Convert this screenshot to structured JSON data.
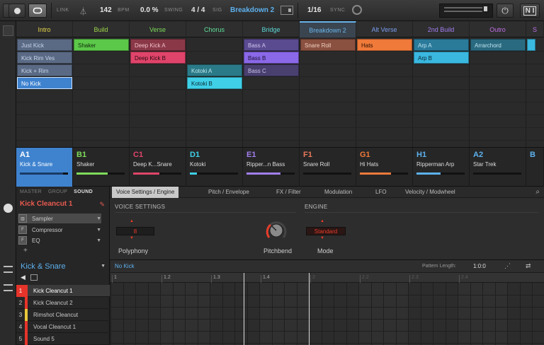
{
  "transport": {
    "link_label": "LINK",
    "tempo": "142",
    "tempo_unit": "BPM",
    "swing": "0.0 %",
    "swing_label": "SWING",
    "signature": "4 / 4",
    "signature_label": "SIG",
    "scene_name": "Breakdown 2",
    "quantize": "1/16",
    "sync_label": "SYNC",
    "accent_color": "#5db1ee"
  },
  "scenes": [
    {
      "label": "Intro",
      "color": "#e8d84a"
    },
    {
      "label": "Build",
      "color": "#9fd84a"
    },
    {
      "label": "Verse",
      "color": "#7edc5a"
    },
    {
      "label": "Chorus",
      "color": "#5ee09a"
    },
    {
      "label": "Bridge",
      "color": "#5ed8d8"
    },
    {
      "label": "Breakdown 2",
      "color": "#6ab4e8",
      "active": true
    },
    {
      "label": "Alt Verse",
      "color": "#7a9ef0"
    },
    {
      "label": "2nd Build",
      "color": "#a27ef0"
    },
    {
      "label": "Outro",
      "color": "#c070e8"
    }
  ],
  "clips": [
    {
      "col": 0,
      "row": 0,
      "label": "Just Kick",
      "color": "#5a6a85",
      "text_color": "#c8d4e8"
    },
    {
      "col": 0,
      "row": 1,
      "label": "Kick Rim Ves",
      "color": "#5a6a85",
      "text_color": "#c8d4e8"
    },
    {
      "col": 0,
      "row": 2,
      "label": "Kick + Rim",
      "color": "#5a6a85",
      "text_color": "#c8d4e8"
    },
    {
      "col": 0,
      "row": 3,
      "label": "No Kick",
      "color": "#3f83cf",
      "text_color": "#ffffff",
      "selected": true
    },
    {
      "col": 1,
      "row": 0,
      "label": "Shaker",
      "color": "#5cc84a",
      "text_color": "#0f2a0a"
    },
    {
      "col": 2,
      "row": 0,
      "label": "Deep Kick A",
      "color": "#8a3848",
      "text_color": "#f0c0c8"
    },
    {
      "col": 2,
      "row": 1,
      "label": "Deep Kick B",
      "color": "#e0446a",
      "text_color": "#2a0a12"
    },
    {
      "col": 3,
      "row": 2,
      "label": "Kotoki A",
      "color": "#2a7a88",
      "text_color": "#c0e8ee"
    },
    {
      "col": 3,
      "row": 3,
      "label": "Kotoki B",
      "color": "#3fd0e8",
      "text_color": "#0a2a30"
    },
    {
      "col": 4,
      "row": 0,
      "label": "Bass A",
      "color": "#5a4a90",
      "text_color": "#d0c8f0"
    },
    {
      "col": 4,
      "row": 1,
      "label": "Bass B",
      "color": "#8a68e8",
      "text_color": "#1a1030"
    },
    {
      "col": 4,
      "row": 2,
      "label": "Bass C",
      "color": "#4a4070",
      "text_color": "#c8c0e8"
    },
    {
      "col": 5,
      "row": 0,
      "label": "Snare Roll",
      "color": "#8a5040",
      "text_color": "#f0d0c0"
    },
    {
      "col": 6,
      "row": 0,
      "label": "Hats",
      "color": "#f07a3a",
      "text_color": "#2a1000"
    },
    {
      "col": 7,
      "row": 0,
      "label": "Arp A",
      "color": "#2a7a9a",
      "text_color": "#c0e4f0"
    },
    {
      "col": 7,
      "row": 1,
      "label": "Arp B",
      "color": "#3ab8e0",
      "text_color": "#0a2430"
    },
    {
      "col": 8,
      "row": 0,
      "label": "Arrarchord",
      "color": "#2a6a80",
      "text_color": "#c0e4f0"
    }
  ],
  "groups": [
    {
      "id": "A1",
      "name": "Kick & Snare",
      "color": "#5db1ee",
      "level": 0.9,
      "selected": true
    },
    {
      "id": "B1",
      "name": "Shaker",
      "color": "#7edc5a",
      "level": 0.65
    },
    {
      "id": "C1",
      "name": "Deep K...Snare",
      "color": "#e0446a",
      "level": 0.55
    },
    {
      "id": "D1",
      "name": "Kotoki",
      "color": "#3fd0e8",
      "level": 0.15
    },
    {
      "id": "E1",
      "name": "Ripper...n Bass",
      "color": "#a27ef0",
      "level": 0.7
    },
    {
      "id": "F1",
      "name": "Snare Roll",
      "color": "#e87a5a",
      "level": 0.0
    },
    {
      "id": "G1",
      "name": "Hi Hats",
      "color": "#f07a3a",
      "level": 0.65
    },
    {
      "id": "H1",
      "name": "Ripperman Arp",
      "color": "#5db1ee",
      "level": 0.5
    },
    {
      "id": "A2",
      "name": "Star Trek",
      "color": "#5db1ee",
      "level": 0.0
    }
  ],
  "sound_panel": {
    "tabs": [
      "MASTER",
      "GROUP",
      "SOUND"
    ],
    "active_tab": "SOUND",
    "sound_name": "Kick Cleancut 1",
    "plugins": [
      {
        "label": "Sampler",
        "icon": "piano-icon",
        "selected": true
      },
      {
        "label": "Compressor",
        "icon": "fx-icon"
      },
      {
        "label": "EQ",
        "icon": "fx-icon"
      }
    ],
    "add_label": "+",
    "param_tabs": [
      "Voice Settings / Engine",
      "Pitch / Envelope",
      "FX / Filter",
      "Modulation",
      "LFO",
      "Velocity / Modwheel"
    ],
    "voice_settings_label": "VOICE SETTINGS",
    "engine_label": "ENGINE",
    "polyphony_value": "8",
    "polyphony_label": "Polyphony",
    "pitchbend_label": "Pitchbend",
    "mode_value": "Standard",
    "mode_label": "Mode"
  },
  "pattern": {
    "group_name": "Kick & Snare",
    "pattern_name": "No Kick",
    "pattern_length_label": "Pattern Length:",
    "pattern_length_value": "1:0:0",
    "ruler": [
      "1",
      "1.2",
      "1.3",
      "1.4",
      "2",
      "2.2",
      "2.3",
      "2.4"
    ],
    "sounds": [
      {
        "num": "1",
        "name": "Kick Cleancut 1",
        "color": "#e6342a",
        "selected": true
      },
      {
        "num": "2",
        "name": "Kick Cleancut 2",
        "color": "#e6342a"
      },
      {
        "num": "3",
        "name": "Rimshot Cleancut",
        "color": "#e8c83a"
      },
      {
        "num": "4",
        "name": "Vocal Cleancut 1",
        "color": "#e6342a"
      },
      {
        "num": "5",
        "name": "Sound 5",
        "color": "#e6342a"
      }
    ]
  }
}
